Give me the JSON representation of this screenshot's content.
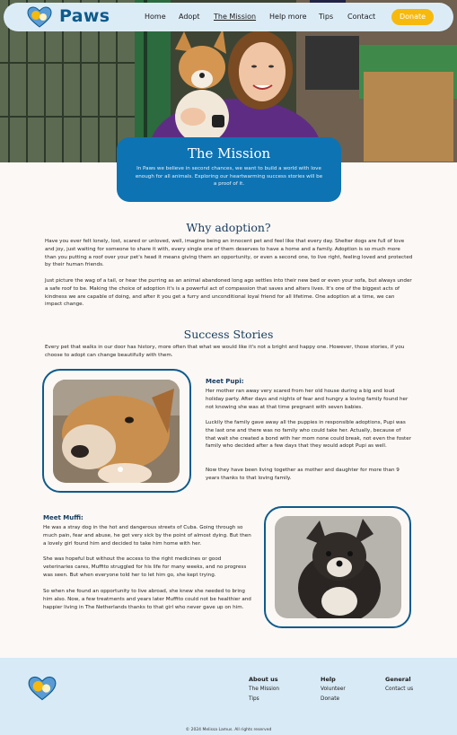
{
  "nav": {
    "brand": "Paws",
    "links": [
      "Home",
      "Adopt",
      "The Mission",
      "Help more",
      "Tips",
      "Contact"
    ],
    "donate": "Donate"
  },
  "hero": {
    "title": "The Mission",
    "subtitle": "In Paws we believe in second chances, we want to build a world with love enough for all animals. Exploring our heartwarming success stories will be a proof of it."
  },
  "why": {
    "title": "Why adoption?",
    "p1": "Have you ever felt lonely, lost, scared or unloved, well, imagine being an innocent pet and feel like that every day. Shelter dogs are full of love and joy, just waiting for someone to share it with, every single one of them deserves to have a home and a family. Adoption is so much more than you putting a roof over your pet's head it means giving them an opportunity, or even a second one, to live right, feeling loved and protected by their human friends.",
    "p2": "Just picture the wag of a tail, or hear the purring as an animal abandoned long ago settles into their new bed or even your sofa, but always under a safe roof to be. Making the choice of adoption it's is a powerful act of compassion that saves and alters lives. It's one of the biggest acts of kindness we are capable of doing, and after it you get a furry and unconditional loyal friend for all lifetime. One adoption at a time, we can impact change."
  },
  "stories": {
    "title": "Success Stories",
    "intro": "Every pet that walks in our door has history, more often that what we would like it's not a bright and happy one. However, those stories, if you choose to adopt can change beautifully with them.",
    "pupi": {
      "name": "Meet Pupi:",
      "p1": "Her mother ran away very scared from her old house during a big and loud holiday party. After days and nights of fear and hungry a loving family found her not knowing she was at that time pregnant with seven babies.",
      "p2": "Luckily the family gave away all the puppies in responsible adoptions, Pupi was the last one and there was no family who could take her. Actually, because of that wait she created a bond with her mom none could break, not even the foster family who decided after a few days that they would adopt Pupi as well.",
      "p3": "Now they have been living together as mother and daughter for more than 9 years thanks to that loving family."
    },
    "muffi": {
      "name": "Meet Muffi:",
      "p1": "He was a stray dog in the hot and dangerous streets of Cuba. Going through so much pain, fear and abuse, he got very sick by the point of almost dying. But then a lovely girl found him and decided to take him home with her.",
      "p2": "She was hopeful but without the access to the right medicines or good veterinaries cares, Muffito struggled for his life for many weeks, and no progress was seen. But when everyone told her to let him go, she kept trying.",
      "p3": "So when she found an opportunity to live abroad, she knew she needed to bring him also. Now, a few treatments and years later Muffito could not be healthier and happier living in The Netherlands thanks to that girl who never gave up on him."
    }
  },
  "footer": {
    "col1": {
      "title": "About us",
      "links": [
        "The Mission",
        "Tips"
      ]
    },
    "col2": {
      "title": "Help",
      "links": [
        "Volunteer",
        "Donate"
      ]
    },
    "col3": {
      "title": "General",
      "links": [
        "Contact us"
      ]
    },
    "copyright": "© 2024 Melissa Lamus. All rights reserved"
  },
  "colors": {
    "primary": "#0e73b3",
    "dark": "#0e5b8c",
    "accent": "#f7b90e",
    "nav_bg": "#dcecf7",
    "footer_bg": "#d8eaf6"
  },
  "icons": {
    "logo": "dog-cat-heart-logo"
  }
}
